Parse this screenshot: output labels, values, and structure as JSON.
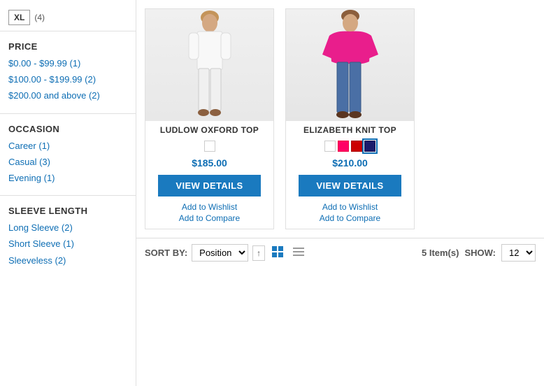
{
  "sidebar": {
    "sizes": [
      {
        "label": "XL",
        "count": "(4)"
      }
    ],
    "price_section": {
      "title": "PRICE",
      "items": [
        {
          "label": "$0.00 - $99.99",
          "count": "(1)"
        },
        {
          "label": "$100.00 - $199.99",
          "count": "(2)"
        },
        {
          "label": "$200.00 and above",
          "count": "(2)"
        }
      ]
    },
    "occasion_section": {
      "title": "OCCASION",
      "items": [
        {
          "label": "Career",
          "count": "(1)"
        },
        {
          "label": "Casual",
          "count": "(3)"
        },
        {
          "label": "Evening",
          "count": "(1)"
        }
      ]
    },
    "sleeve_section": {
      "title": "SLEEVE LENGTH",
      "items": [
        {
          "label": "Long Sleeve",
          "count": "(2)"
        },
        {
          "label": "Short Sleeve",
          "count": "(1)"
        },
        {
          "label": "Sleeveless",
          "count": "(2)"
        }
      ]
    }
  },
  "products": [
    {
      "name": "LUDLOW OXFORD TOP",
      "price": "$185.00",
      "swatches": [
        "white"
      ],
      "view_details_label": "VIEW DETAILS",
      "wishlist_label": "Add to Wishlist",
      "compare_label": "Add to Compare"
    },
    {
      "name": "ELIZABETH KNIT TOP",
      "price": "$210.00",
      "swatches": [
        "white",
        "pink",
        "red",
        "navy"
      ],
      "view_details_label": "VIEW DETAILS",
      "wishlist_label": "Add to Wishlist",
      "compare_label": "Add to Compare"
    }
  ],
  "sort_bar": {
    "sort_label": "SORT BY:",
    "sort_option": "Position",
    "items_count": "5",
    "items_label": "Item(s)",
    "show_label": "SHOW:",
    "show_value": "12"
  }
}
